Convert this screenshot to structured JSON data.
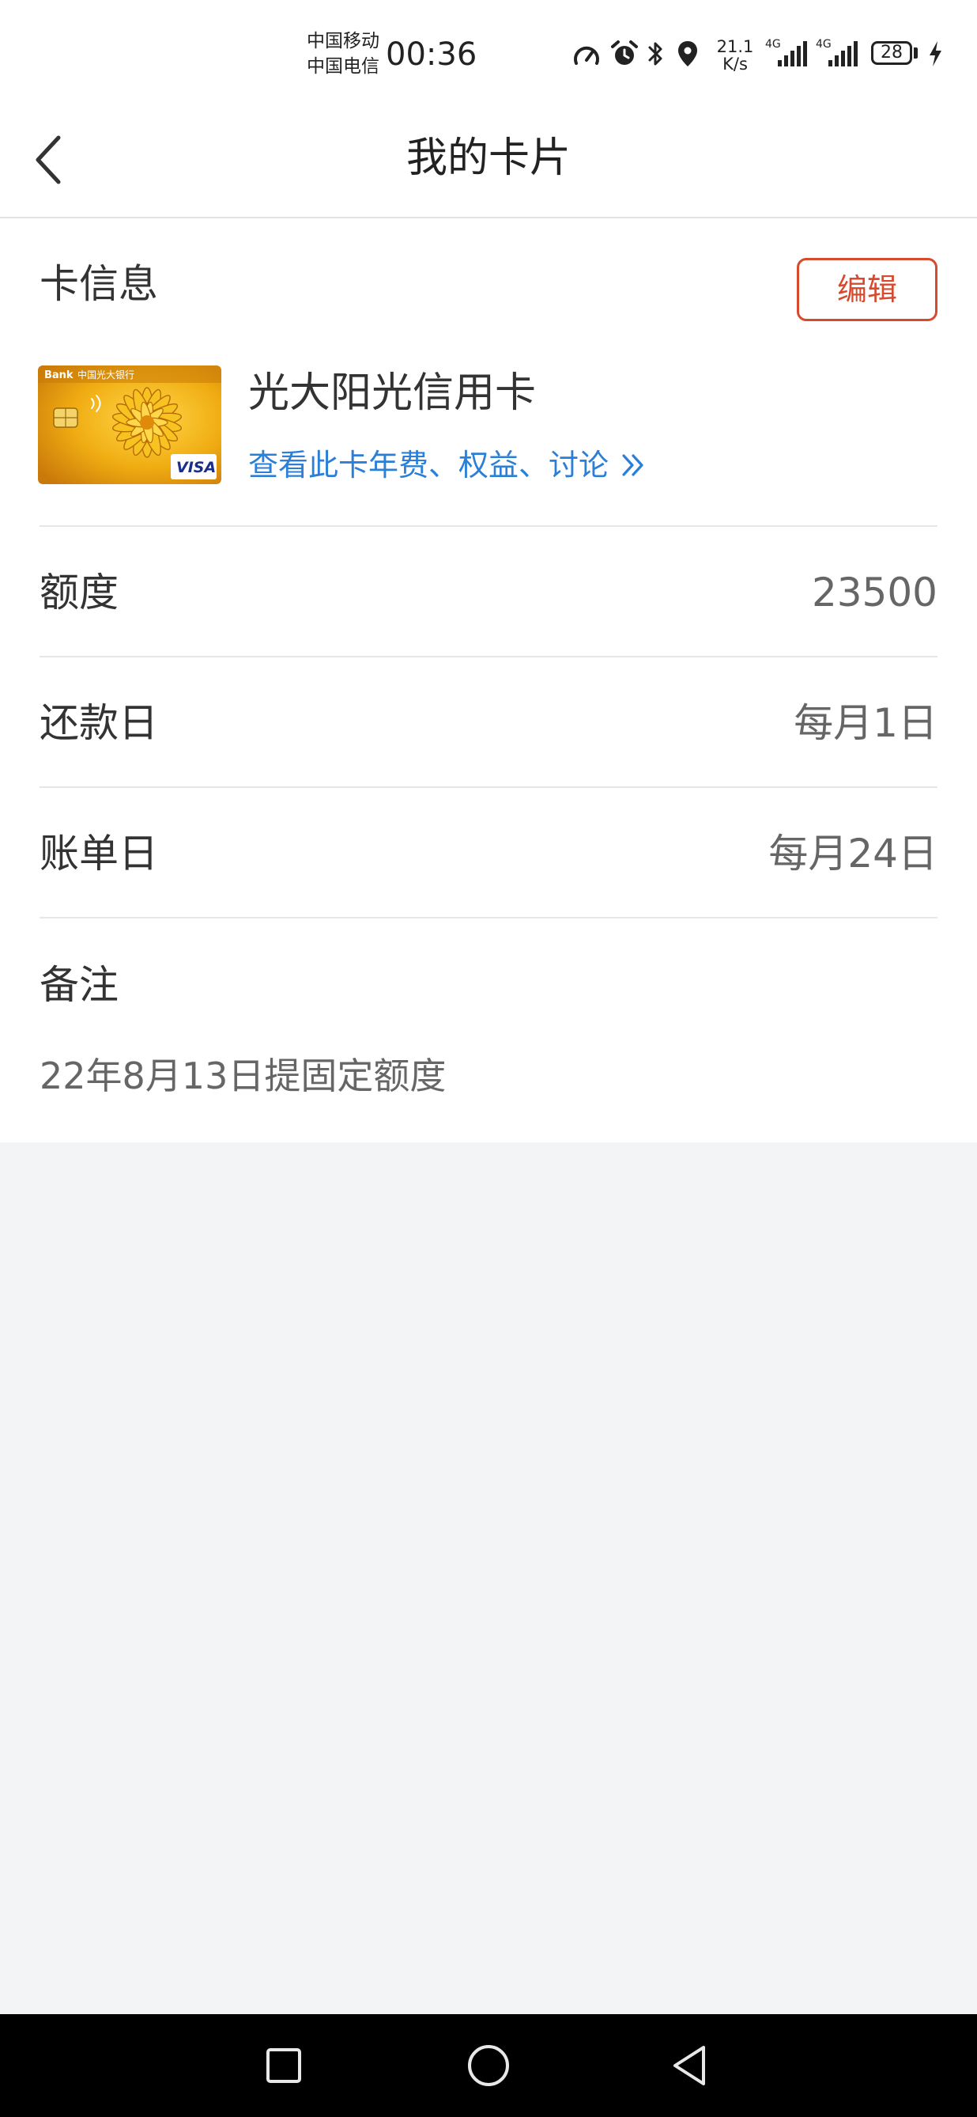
{
  "status_bar": {
    "carrier_1": "中国移动",
    "carrier_2": "中国电信",
    "time": "00:36",
    "net_speed_value": "21.1",
    "net_speed_unit": "K/s",
    "sim1_label": "4G",
    "sim2_label": "4G",
    "battery": "28",
    "icons": [
      "speed-gauge-icon",
      "alarm-icon",
      "bluetooth-icon",
      "location-icon",
      "signal-icon",
      "signal-icon",
      "battery-icon",
      "charging-icon"
    ]
  },
  "header": {
    "title": "我的卡片",
    "back_icon": "chevron-left-icon"
  },
  "card_info": {
    "section_title": "卡信息",
    "edit_label": "编辑",
    "card_name": "光大阳光信用卡",
    "card_link": "查看此卡年费、权益、讨论",
    "card_thumb_bank": "中国光大银行",
    "card_thumb_brand": "VISA",
    "card_thumb_prefix": "Bank"
  },
  "rows": [
    {
      "label": "额度",
      "value": "23500"
    },
    {
      "label": "还款日",
      "value": "每月1日"
    },
    {
      "label": "账单日",
      "value": "每月24日"
    }
  ],
  "note": {
    "label": "备注",
    "text": "22年8月13日提固定额度"
  },
  "colors": {
    "accent_red": "#d74a2e",
    "link_blue": "#2b7fd6",
    "page_background": "#f3f4f6"
  },
  "nav_bar": {
    "icons": [
      "recent-apps-square-icon",
      "home-circle-icon",
      "back-triangle-icon"
    ]
  }
}
